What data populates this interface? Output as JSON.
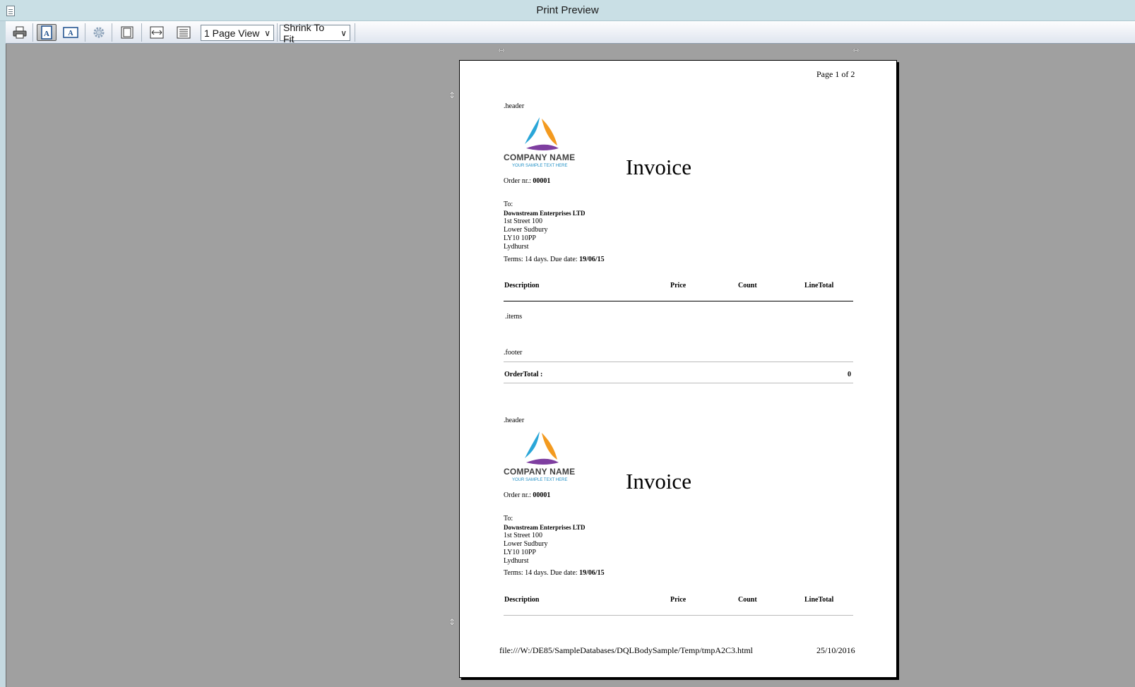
{
  "window": {
    "title": "Print Preview"
  },
  "toolbar": {
    "page_view": "1 Page View",
    "shrink": "Shrink To Fit"
  },
  "page": {
    "page_label": "Page 1 of 2",
    "footer_path": "file:///W:/DE85/SampleDatabases/DQLBodySample/Temp/tmpA2C3.html",
    "footer_date": "25/10/2016",
    "header_marker": ".header",
    "items_marker": ".items",
    "footer_marker": ".footer",
    "company_name": "COMPANY NAME",
    "company_tagline": "YOUR SAMPLE TEXT HERE",
    "invoice_title": "Invoice",
    "order_label": "Order nr.:",
    "order_number": "00001",
    "to_label": "To:",
    "address_name": "Downstream Enterprises LTD",
    "address_line1": "1st Street 100",
    "address_line2": "Lower Sudbury",
    "address_line3": "LY10 10PP",
    "address_line4": "Lydhurst",
    "terms_label": "Terms: 14 days. Due date:",
    "due_date": "19/06/15",
    "columns": {
      "description": "Description",
      "price": "Price",
      "count": "Count",
      "linetotal": "LineTotal"
    },
    "order_total_label": "OrderTotal :",
    "order_total_value": "0"
  }
}
